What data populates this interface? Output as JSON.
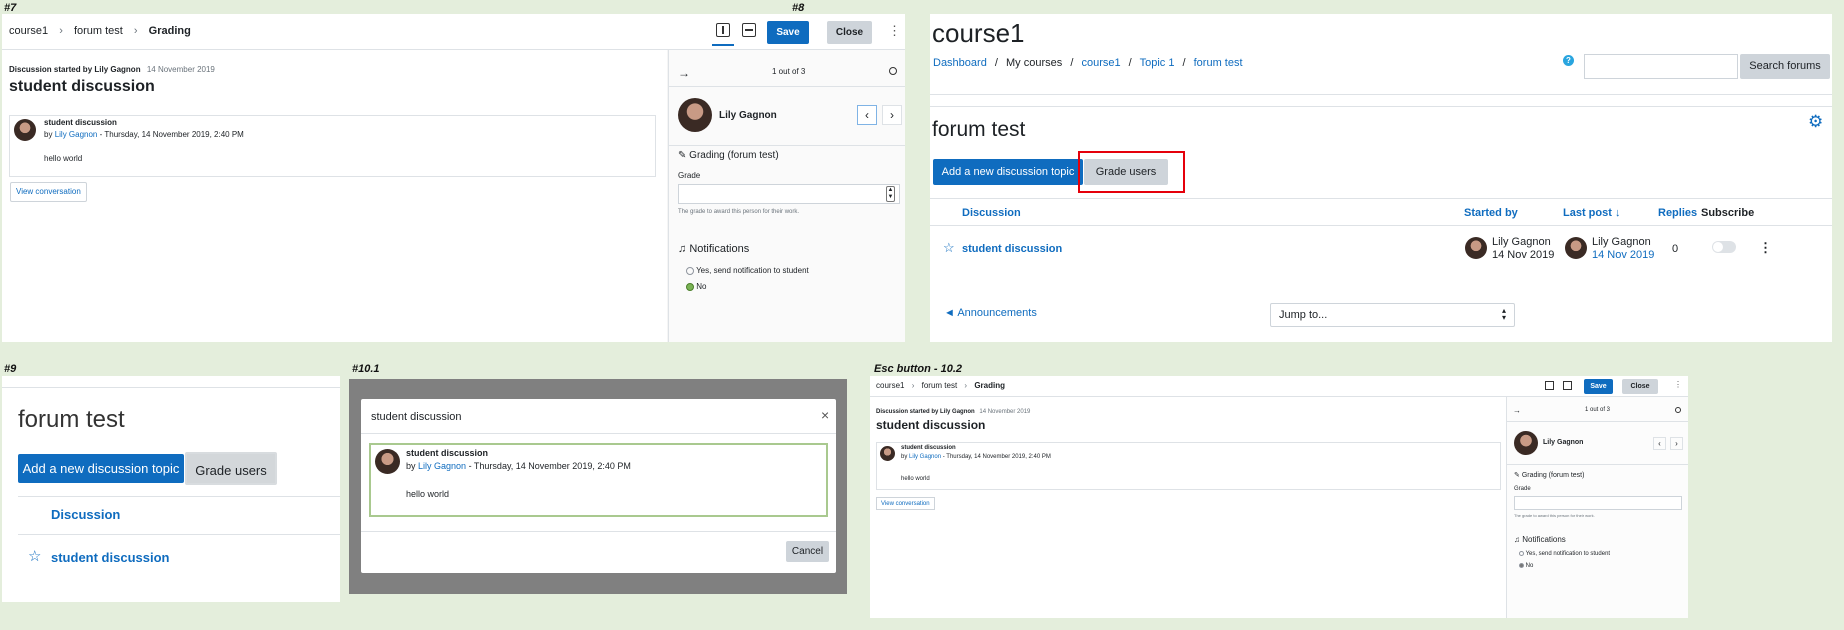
{
  "labels": {
    "p7": "#7",
    "p8": "#8",
    "p9": "#9",
    "p101": "#10.1",
    "p102": "Esc button - 10.2"
  },
  "grading": {
    "breadcrumb": [
      "course1",
      "forum test",
      "Grading"
    ],
    "sep": "›",
    "save_label": "Save",
    "close_label": "Close",
    "more_glyph": "⋮",
    "started_prefix": "Discussion started by Lily Gagnon",
    "started_date": "14 November 2019",
    "title": "student discussion",
    "post_subject": "student discussion",
    "post_by": "by",
    "post_author": "Lily Gagnon",
    "post_date": "- Thursday, 14 November 2019, 2:40 PM",
    "post_body": "hello world",
    "view_conversation": "View conversation",
    "pager": "1 out of 3",
    "user_name": "Lily Gagnon",
    "grading_heading": "Grading (forum test)",
    "grade_label": "Grade",
    "grade_help": "The grade to award this person for their work.",
    "notifications_heading": "Notifications",
    "notify_yes": "Yes, send notification to student",
    "notify_no": "No"
  },
  "forum": {
    "course_title": "course1",
    "breadcrumb": [
      "Dashboard",
      "My courses",
      "course1",
      "Topic 1",
      "forum test"
    ],
    "bc_sep": "/",
    "help_glyph": "?",
    "search_placeholder": "",
    "search_button": "Search forums",
    "forum_title": "forum test",
    "add_topic": "Add a new discussion topic",
    "grade_users": "Grade users",
    "columns": {
      "discussion": "Discussion",
      "started_by": "Started by",
      "last_post": "Last post",
      "replies": "Replies",
      "subscribe": "Subscribe"
    },
    "sort_arrow": "↓",
    "row": {
      "title": "student discussion",
      "started_name": "Lily Gagnon",
      "started_date": "14 Nov 2019",
      "last_name": "Lily Gagnon",
      "last_date": "14 Nov 2019",
      "replies": "0"
    },
    "prev_link": "◄ Announcements",
    "jump_to": "Jump to...",
    "gear_glyph": "⚙",
    "highlight_color": "#e5000b"
  },
  "zoom": {
    "forum_title": "forum test",
    "add_topic": "Add a new discussion topic",
    "grade_users": "Grade users",
    "column": "Discussion",
    "row_title": "student discussion"
  },
  "modal": {
    "title": "student discussion",
    "close_glyph": "×",
    "post_subject": "student discussion",
    "post_by": "by",
    "post_author": "Lily Gagnon",
    "post_date": "- Thursday, 14 November 2019, 2:40 PM",
    "post_body": "hello world",
    "cancel": "Cancel"
  }
}
